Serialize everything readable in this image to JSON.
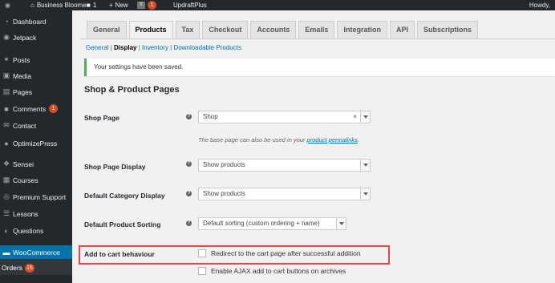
{
  "admin_bar": {
    "site_name": "Business Bloomer",
    "comments_count": "1",
    "new_label": "New",
    "yoast_icon": "Y",
    "yoast_count": "1",
    "updraft_label": "UpdraftPlus",
    "howdy": "Howdy,"
  },
  "sidebar": {
    "items": [
      {
        "label": "Dashboard",
        "icon": "dashboard-icon",
        "glyph": "◔"
      },
      {
        "label": "Jetpack",
        "icon": "jetpack-icon",
        "glyph": "◉"
      },
      {
        "label": "Posts",
        "icon": "pin-icon",
        "glyph": "✶"
      },
      {
        "label": "Media",
        "icon": "media-icon",
        "glyph": "▣"
      },
      {
        "label": "Pages",
        "icon": "pages-icon",
        "glyph": "▤"
      },
      {
        "label": "Comments",
        "icon": "comments-icon",
        "glyph": "■",
        "badge": "1"
      },
      {
        "label": "Contact",
        "icon": "mail-icon",
        "glyph": "✉"
      },
      {
        "label": "OptimizePress",
        "icon": "optimizepress-icon",
        "glyph": "●"
      },
      {
        "label": "Sensei",
        "icon": "sensei-icon",
        "glyph": "❖"
      },
      {
        "label": "Courses",
        "icon": "courses-icon",
        "glyph": "▦"
      },
      {
        "label": "Premium Support",
        "icon": "support-icon",
        "glyph": "◎"
      },
      {
        "label": "Lessons",
        "icon": "lessons-icon",
        "glyph": "☰"
      },
      {
        "label": "Questions",
        "icon": "questions-icon",
        "glyph": "◐"
      },
      {
        "label": "WooCommerce",
        "icon": "woocommerce-icon",
        "glyph": "▬"
      }
    ],
    "orders_label": "Orders",
    "orders_badge": "15"
  },
  "tabs": [
    "General",
    "Products",
    "Tax",
    "Checkout",
    "Accounts",
    "Emails",
    "Integration",
    "API",
    "Subscriptions"
  ],
  "active_tab": "Products",
  "subsections": {
    "general": "General",
    "display": "Display",
    "inventory": "Inventory",
    "downloadable": "Downloadable Products"
  },
  "notice": "Your settings have been saved.",
  "section_title": "Shop & Product Pages",
  "fields": {
    "shop_page": {
      "label": "Shop Page",
      "value": "Shop",
      "clear": "×"
    },
    "shop_page_desc_prefix": "The base page can also be used in your",
    "shop_page_desc_link": "product permalinks",
    "shop_page_desc_suffix": ".",
    "shop_page_display": {
      "label": "Shop Page Display",
      "value": "Show products"
    },
    "category_display": {
      "label": "Default Category Display",
      "value": "Show products"
    },
    "product_sorting": {
      "label": "Default Product Sorting",
      "value": "Default sorting (custom ordering + name)"
    },
    "add_to_cart": {
      "label": "Add to cart behaviour",
      "redirect": "Redirect to the cart page after successful addition",
      "ajax": "Enable AJAX add to cart buttons on archives"
    }
  },
  "colors": {
    "accent": "#0073aa",
    "highlight": "#e04a4a",
    "success": "#46b450"
  }
}
